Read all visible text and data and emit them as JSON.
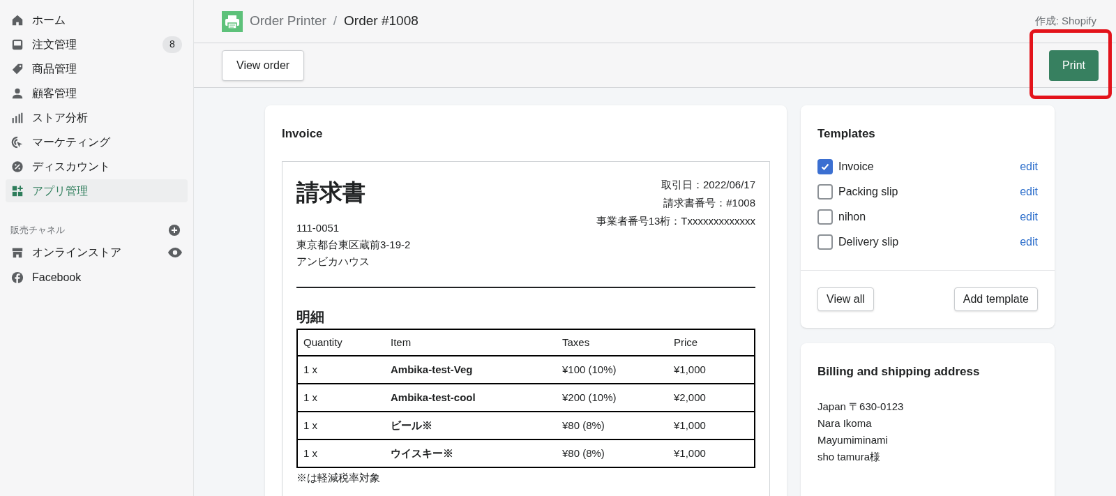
{
  "sidebar": {
    "items": [
      {
        "label": "ホーム",
        "selected": false
      },
      {
        "label": "注文管理",
        "badge": "8",
        "selected": false
      },
      {
        "label": "商品管理",
        "selected": false
      },
      {
        "label": "顧客管理",
        "selected": false
      },
      {
        "label": "ストア分析",
        "selected": false
      },
      {
        "label": "マーケティング",
        "selected": false
      },
      {
        "label": "ディスカウント",
        "selected": false
      },
      {
        "label": "アプリ管理",
        "selected": true
      }
    ],
    "channels_heading": "販売チャネル",
    "channels": [
      {
        "label": "オンラインストア"
      },
      {
        "label": "Facebook"
      }
    ]
  },
  "header": {
    "app": "Order Printer",
    "separator": "/",
    "page": "Order #1008",
    "credit": "作成: Shopify"
  },
  "toolbar": {
    "view_button": "View order",
    "print_button": {
      "label": "Print",
      "highlighted": true
    }
  },
  "invoice": {
    "heading": "Invoice",
    "document": {
      "title": "請求書",
      "meta": [
        "取引日：2022/06/17",
        "請求書番号：#1008",
        "事業者番号13桁：Txxxxxxxxxxxxx"
      ],
      "address": [
        "111-0051",
        "東京都台東区蔵前3-19-2",
        "アンビカハウス"
      ],
      "section": "明細",
      "columns": [
        "Quantity",
        "Item",
        "Taxes",
        "Price"
      ],
      "rows": [
        [
          "1 x",
          "Ambika-test-Veg",
          "¥100 (10%)",
          "¥1,000"
        ],
        [
          "1 x",
          "Ambika-test-cool",
          "¥200 (10%)",
          "¥2,000"
        ],
        [
          "1 x",
          "ビール※",
          "¥80 (8%)",
          "¥1,000"
        ],
        [
          "1 x",
          "ウイスキー※",
          "¥80 (8%)",
          "¥1,000"
        ]
      ],
      "note": "※は軽減税率対象"
    }
  },
  "templates": {
    "heading": "Templates",
    "items": [
      {
        "label": "Invoice",
        "checked": true,
        "action": "edit"
      },
      {
        "label": "Packing slip",
        "checked": false,
        "action": "edit"
      },
      {
        "label": "nihon",
        "checked": false,
        "action": "edit"
      },
      {
        "label": "Delivery slip",
        "checked": false,
        "action": "edit"
      }
    ],
    "buttons": [
      "View all",
      "Add template"
    ]
  },
  "billing": {
    "heading": "Billing and shipping address",
    "lines": [
      "Japan 〒630-0123",
      "Nara Ikoma",
      "Mayumiminami",
      "sho tamura様"
    ]
  }
}
